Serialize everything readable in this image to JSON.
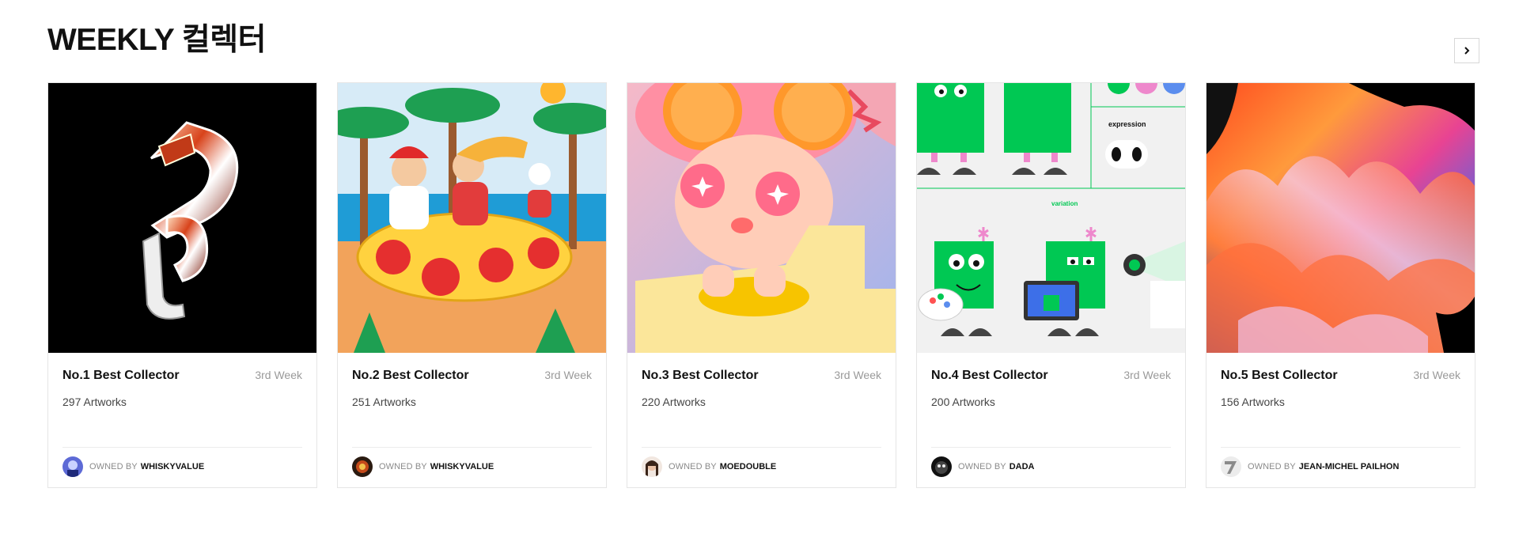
{
  "section": {
    "title": "WEEKLY 컬렉터",
    "next_icon": "chevron-right-icon"
  },
  "cards": [
    {
      "title": "No.1 Best Collector",
      "week": "3rd Week",
      "artworks": "297 Artworks",
      "owner_prefix": "OWNED BY",
      "owner_name": "WHISKYVALUE",
      "image": "chrome-letter-artwork"
    },
    {
      "title": "No.2 Best Collector",
      "week": "3rd Week",
      "artworks": "251 Artworks",
      "owner_prefix": "OWNED BY",
      "owner_name": "WHISKYVALUE",
      "image": "beach-illustration-artwork"
    },
    {
      "title": "No.3  Best Collector",
      "week": "3rd Week",
      "artworks": "220 Artworks",
      "owner_prefix": "OWNED BY",
      "owner_name": "MOEDOUBLE",
      "image": "toy-figure-artwork"
    },
    {
      "title": "No.4 Best Collector",
      "week": "3rd Week",
      "artworks": "200 Artworks",
      "owner_prefix": "OWNED BY",
      "owner_name": "DADA",
      "image": "green-robot-characters-artwork",
      "image_labels": [
        "expression",
        "variation"
      ]
    },
    {
      "title": "No.5 Best Collector",
      "week": "3rd Week",
      "artworks": "156 Artworks",
      "owner_prefix": "OWNED BY",
      "owner_name": "JEAN-MICHEL PAILHON",
      "image": "abstract-fluid-artwork"
    }
  ],
  "colors": {
    "title": "#111111",
    "muted": "#9a9a9a",
    "border": "#e5e5e5",
    "robot_green": "#00c853"
  }
}
